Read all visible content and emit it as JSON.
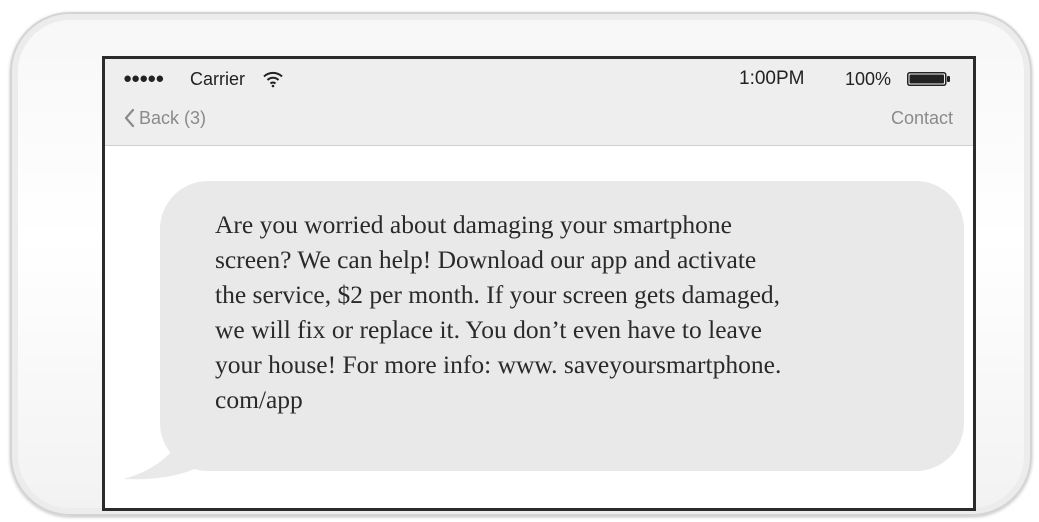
{
  "status_bar": {
    "signal": "●●●●●",
    "carrier": "Carrier",
    "wifi_icon": "wifi-icon",
    "time": "1:00PM",
    "battery_percent": "100%",
    "battery_icon": "battery-icon",
    "battery_level": 1.0
  },
  "nav": {
    "back_icon": "chevron-left-icon",
    "back_label": "Back (3)",
    "contact_label": "Contact"
  },
  "message": {
    "text": "Are you worried about damaging your smartphone\nscreen? We can help! Download our app and activate\nthe service, $2 per month. If your screen gets damaged,\nwe will fix or replace it. You don’t even have to leave\nyour house! For more info: www. saveyoursmartphone.\ncom/app"
  },
  "colors": {
    "bubble": "#e9e9e9",
    "topbar": "#eeeeee",
    "nav_text": "#8a8a8a",
    "screen_border": "#2b2b2b"
  }
}
